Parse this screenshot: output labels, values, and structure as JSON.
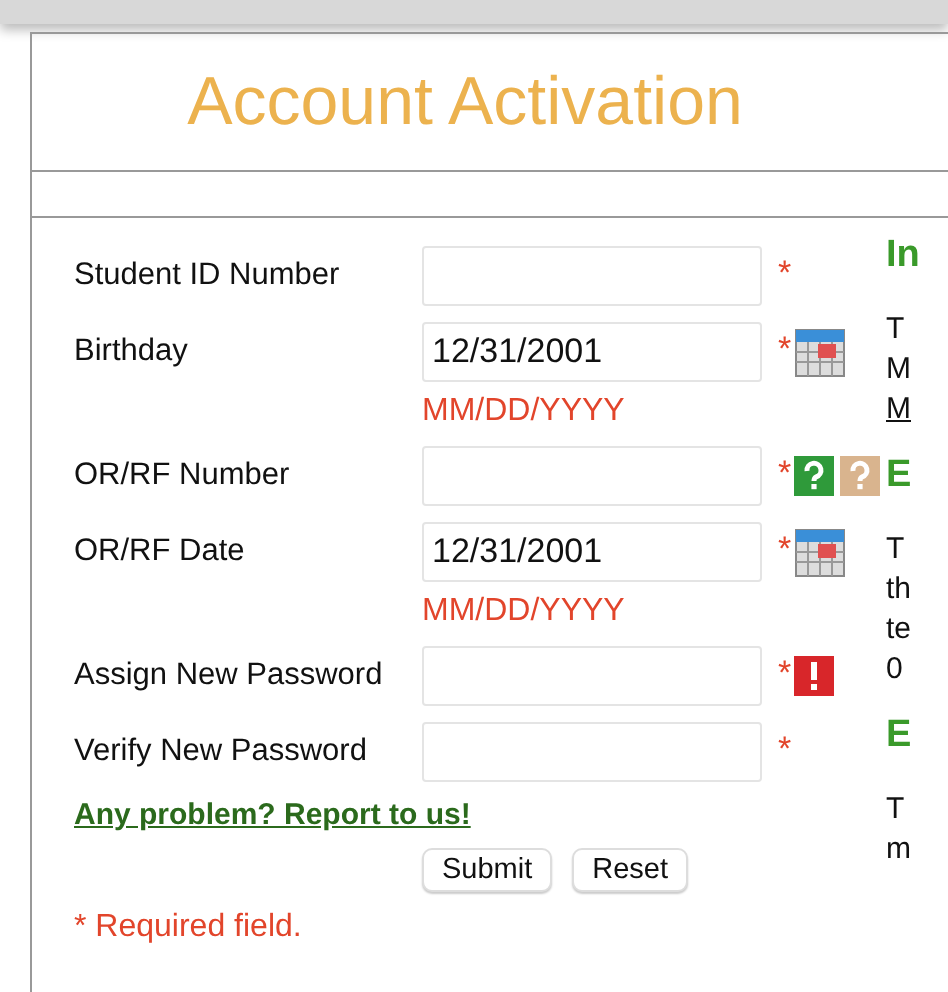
{
  "title": "Account Activation",
  "fields": [
    {
      "label": "Student ID Number",
      "required": true
    },
    {
      "label": "Birthday",
      "value": "12/31/2001",
      "required": true,
      "hint": "MM/DD/YYYY",
      "icons": [
        {
          "kind": "calendar"
        }
      ]
    },
    {
      "label": "OR/RF Number",
      "required": true,
      "icons": [
        {
          "kind": "help"
        },
        {
          "kind": "help-muted"
        }
      ]
    },
    {
      "label": "OR/RF Date",
      "value": "12/31/2001",
      "required": true,
      "hint": "MM/DD/YYYY",
      "icons": [
        {
          "kind": "calendar"
        }
      ]
    },
    {
      "label": "Assign New Password",
      "required": true,
      "icons": [
        {
          "kind": "error"
        }
      ]
    },
    {
      "label": "Verify New Password",
      "required": true
    }
  ],
  "report_link": "Any problem? Report to us!",
  "buttons": [
    "Submit",
    "Reset"
  ],
  "required_note": "* Required field.",
  "required_mark": "*",
  "side_sections": [
    {
      "heading": "In",
      "lines": [
        {
          "text": "T",
          "link": false
        },
        {
          "text": "M",
          "link": false
        },
        {
          "text": "M",
          "link": true
        }
      ]
    },
    {
      "heading": "E",
      "lines": [
        {
          "text": "T",
          "link": false
        },
        {
          "text": "th",
          "link": false
        },
        {
          "text": "te",
          "link": false
        },
        {
          "text": "0",
          "link": false
        }
      ]
    },
    {
      "heading": "E",
      "lines": [
        {
          "text": "T",
          "link": false
        },
        {
          "text": "m",
          "link": false
        }
      ]
    }
  ]
}
